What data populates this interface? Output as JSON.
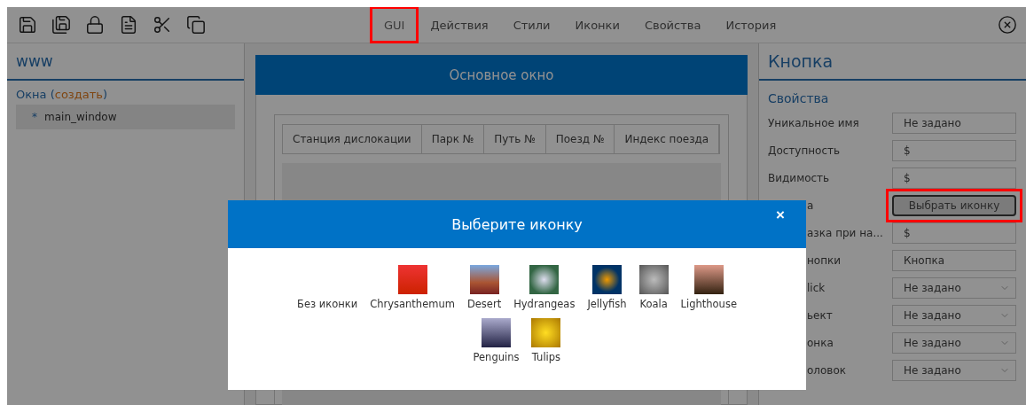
{
  "toolbar": {
    "tabs": [
      {
        "label": "GUI",
        "selected": true,
        "highlighted": true
      },
      {
        "label": "Действия",
        "selected": false,
        "highlighted": false
      },
      {
        "label": "Стили",
        "selected": false,
        "highlighted": false
      },
      {
        "label": "Иконки",
        "selected": false,
        "highlighted": false
      },
      {
        "label": "Свойства",
        "selected": false,
        "highlighted": false
      },
      {
        "label": "История",
        "selected": false,
        "highlighted": false
      }
    ]
  },
  "sidebar": {
    "title": "www",
    "section": {
      "prefix": "Окна (",
      "link": "создать",
      "suffix": ")"
    },
    "items": [
      {
        "bullet": "*",
        "label": "main_window",
        "selected": true
      }
    ]
  },
  "canvas": {
    "window_title": "Основное окно",
    "table": {
      "columns": [
        "Станция дислокации",
        "Парк №",
        "Путь №",
        "Поезд №",
        "Индекс поезда"
      ]
    }
  },
  "properties": {
    "title": "Кнопка",
    "section": "Свойства",
    "rows": [
      {
        "label": "Уникальное имя",
        "clipped": false,
        "kind": "input",
        "value": "Не задано"
      },
      {
        "label": "Доступность",
        "clipped": false,
        "kind": "input",
        "value": "$"
      },
      {
        "label": "Видимость",
        "clipped": false,
        "kind": "input",
        "value": "$"
      },
      {
        "label": "а",
        "clipped": true,
        "kind": "button",
        "value": "Выбрать иконку",
        "highlighted": true
      },
      {
        "label": "азка при на...",
        "clipped": true,
        "kind": "input",
        "value": "$"
      },
      {
        "label": "нопки",
        "clipped": true,
        "kind": "input",
        "value": "Кнопка"
      },
      {
        "label": "lick",
        "clipped": true,
        "kind": "select",
        "value": "Не задано"
      },
      {
        "label": "ьект",
        "clipped": true,
        "kind": "select",
        "value": "Не задано"
      },
      {
        "label": "онка",
        "clipped": true,
        "kind": "select",
        "value": "Не задано"
      },
      {
        "label": "оловок",
        "clipped": true,
        "kind": "select",
        "value": "Не задано"
      }
    ]
  },
  "dialog": {
    "title": "Выберите иконку",
    "close": "×",
    "items": [
      {
        "kind": "none",
        "label": "Без иконки"
      },
      {
        "kind": "image",
        "label": "Chrysanthemum"
      },
      {
        "kind": "image",
        "label": "Desert"
      },
      {
        "kind": "image",
        "label": "Hydrangeas"
      },
      {
        "kind": "image",
        "label": "Jellyfish"
      },
      {
        "kind": "image",
        "label": "Koala"
      },
      {
        "kind": "image",
        "label": "Lighthouse"
      },
      {
        "kind": "image",
        "label": "Penguins"
      },
      {
        "kind": "image",
        "label": "Tulips"
      }
    ]
  }
}
